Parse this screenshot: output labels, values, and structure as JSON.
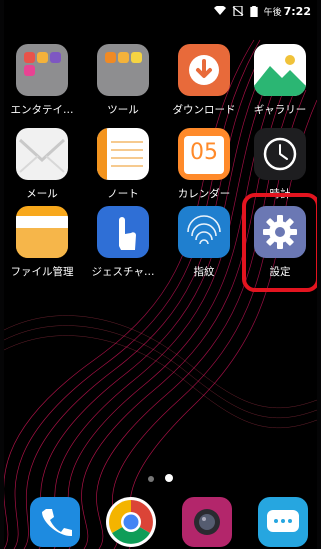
{
  "status_bar": {
    "ampm": "午後",
    "time": "7:22"
  },
  "apps": [
    {
      "label": "エンタテイ…",
      "icon": "folder-icon"
    },
    {
      "label": "ツール",
      "icon": "folder-icon"
    },
    {
      "label": "ダウンロード",
      "icon": "download-icon"
    },
    {
      "label": "ギャラリー",
      "icon": "gallery-icon"
    },
    {
      "label": "メール",
      "icon": "mail-icon"
    },
    {
      "label": "ノート",
      "icon": "note-icon"
    },
    {
      "label": "カレンダー",
      "icon": "calendar-icon"
    },
    {
      "label": "時計",
      "icon": "clock-icon"
    },
    {
      "label": "ファイル管理",
      "icon": "file-manager-icon"
    },
    {
      "label": "ジェスチャ…",
      "icon": "gesture-icon"
    },
    {
      "label": "指紋",
      "icon": "fingerprint-icon"
    },
    {
      "label": "設定",
      "icon": "settings-gear-icon"
    }
  ],
  "calendar_day": "05",
  "dock": [
    {
      "icon": "phone-icon"
    },
    {
      "icon": "chrome-icon"
    },
    {
      "icon": "camera-icon"
    },
    {
      "icon": "messages-icon"
    }
  ],
  "pager": {
    "pages": 2,
    "current": 2
  },
  "colors": {
    "highlight": "#e3141f"
  }
}
